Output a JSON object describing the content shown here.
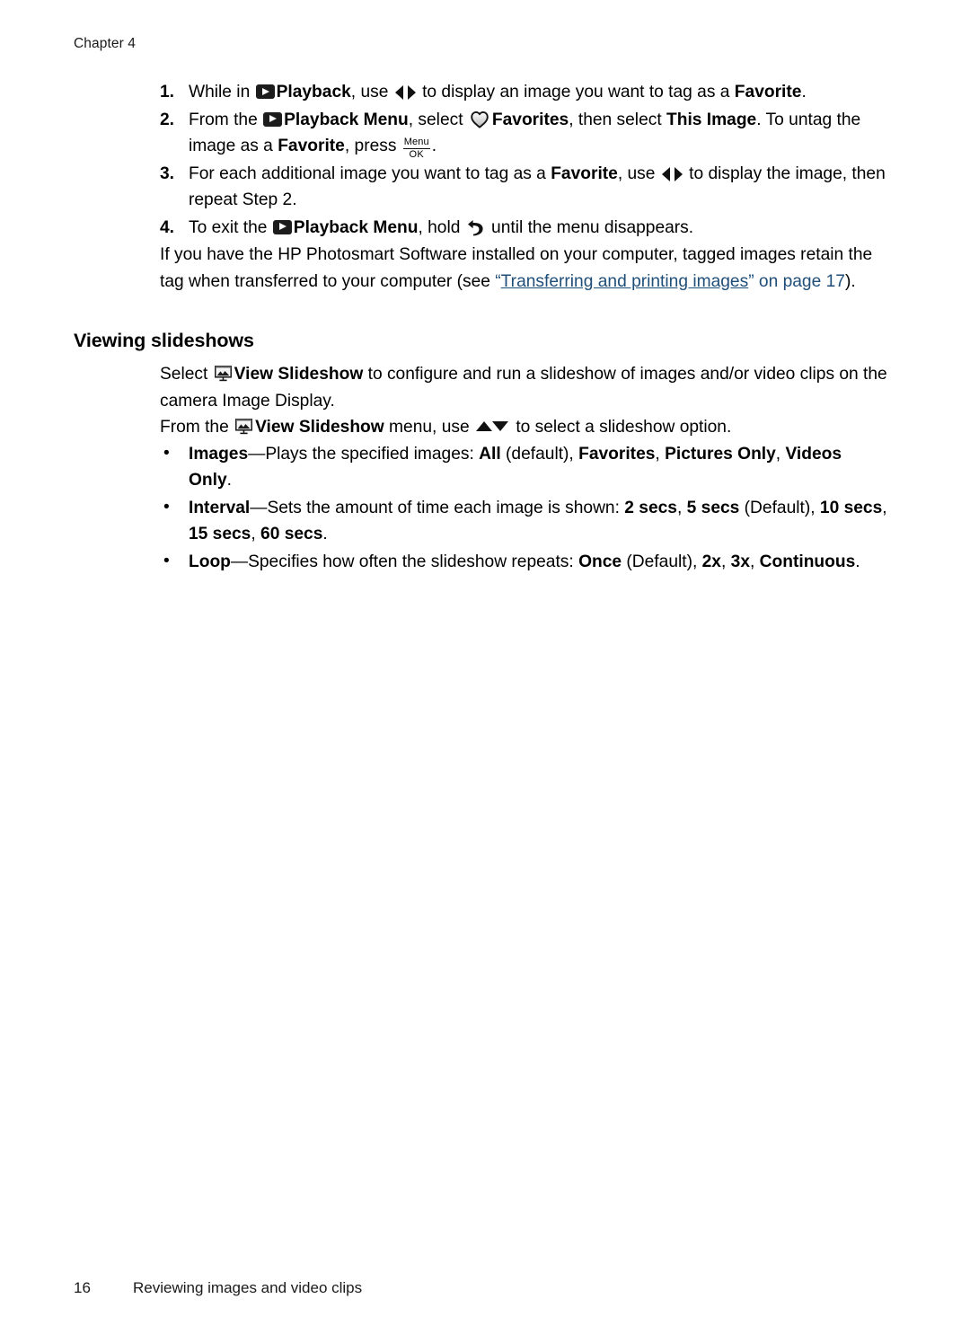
{
  "document": {
    "chapter_header": "Chapter 4",
    "page_number": "16",
    "footer_title": "Reviewing images and video clips",
    "link_color": "#1f4e79",
    "text_color": "#000000",
    "icon_color": "#1c1c1c"
  },
  "steps": [
    {
      "number": "1.",
      "segments": [
        {
          "type": "text",
          "value": "While in "
        },
        {
          "type": "icon",
          "name": "playback-icon"
        },
        {
          "type": "bold",
          "value": "Playback"
        },
        {
          "type": "text",
          "value": ", use "
        },
        {
          "type": "icon",
          "name": "left-right-arrows-icon"
        },
        {
          "type": "text",
          "value": " to display an image you want to tag as a "
        },
        {
          "type": "bold",
          "value": "Favorite"
        },
        {
          "type": "text",
          "value": "."
        }
      ],
      "plain": "While in Playback, use to display an image you want to tag as a Favorite."
    },
    {
      "number": "2.",
      "segments": [
        {
          "type": "text",
          "value": "From the "
        },
        {
          "type": "icon",
          "name": "playback-icon"
        },
        {
          "type": "bold",
          "value": "Playback Menu"
        },
        {
          "type": "text",
          "value": ", select "
        },
        {
          "type": "icon",
          "name": "heart-favorites-icon"
        },
        {
          "type": "bold",
          "value": "Favorites"
        },
        {
          "type": "text",
          "value": ", then select "
        },
        {
          "type": "bold",
          "value": "This Image"
        },
        {
          "type": "text",
          "value": ". To untag the image as a "
        },
        {
          "type": "bold",
          "value": "Favorite"
        },
        {
          "type": "text",
          "value": ", press "
        },
        {
          "type": "icon",
          "name": "menu-ok-button-icon",
          "top": "Menu",
          "bottom": "OK"
        },
        {
          "type": "text",
          "value": "."
        }
      ],
      "plain": "From the Playback Menu, select Favorites, then select This Image. To untag the image as a Favorite, press Menu/OK."
    },
    {
      "number": "3.",
      "segments": [
        {
          "type": "text",
          "value": "For each additional image you want to tag as a "
        },
        {
          "type": "bold",
          "value": "Favorite"
        },
        {
          "type": "text",
          "value": ", use "
        },
        {
          "type": "icon",
          "name": "left-right-arrows-icon"
        },
        {
          "type": "text",
          "value": " to display the image, then repeat Step 2."
        }
      ],
      "plain": "For each additional image you want to tag as a Favorite, use to display the image, then repeat Step 2."
    },
    {
      "number": "4.",
      "segments": [
        {
          "type": "text",
          "value": "To exit the "
        },
        {
          "type": "icon",
          "name": "playback-icon"
        },
        {
          "type": "bold",
          "value": "Playback Menu"
        },
        {
          "type": "text",
          "value": ", hold "
        },
        {
          "type": "icon",
          "name": "back-arrow-icon"
        },
        {
          "type": "text",
          "value": " until the menu disappears."
        }
      ],
      "plain": "To exit the Playback Menu, hold until the menu disappears."
    }
  ],
  "note_paragraph": {
    "lead": "If you have the HP Photosmart Software installed on your computer, tagged images retain the tag when transferred to your computer (see ",
    "open_quote": "“",
    "link_text": "Transferring and printing images",
    "close_quote": "”",
    "link_suffix": "on page 17",
    "tail": ")."
  },
  "section": {
    "heading": "Viewing slideshows",
    "paragraphs": [
      {
        "segments": [
          {
            "type": "text",
            "value": "Select "
          },
          {
            "type": "icon",
            "name": "slideshow-icon"
          },
          {
            "type": "bold",
            "value": "View Slideshow"
          },
          {
            "type": "text",
            "value": " to configure and run a slideshow of images and/or video clips on the camera Image Display."
          }
        ],
        "plain": "Select View Slideshow to configure and run a slideshow of images and/or video clips on the camera Image Display."
      },
      {
        "segments": [
          {
            "type": "text",
            "value": "From the "
          },
          {
            "type": "icon",
            "name": "slideshow-icon"
          },
          {
            "type": "bold",
            "value": "View Slideshow"
          },
          {
            "type": "text",
            "value": " menu, use "
          },
          {
            "type": "icon",
            "name": "up-down-arrows-icon"
          },
          {
            "type": "text",
            "value": " to select a slideshow option."
          }
        ],
        "plain": "From the View Slideshow menu, use to select a slideshow option."
      }
    ],
    "bullets": [
      {
        "bullet": "•",
        "term": "Images",
        "dash": "—",
        "description": "Plays the specified images: ",
        "options": [
          {
            "label": "All",
            "bold": true,
            "note": " (default), "
          },
          {
            "label": "Favorites",
            "bold": true,
            "note": ", "
          },
          {
            "label": "Pictures Only",
            "bold": true,
            "note": ", "
          },
          {
            "label": "Videos Only",
            "bold": true,
            "note": "."
          }
        ],
        "plain": "Images—Plays the specified images: All (default), Favorites, Pictures Only, Videos Only."
      },
      {
        "bullet": "•",
        "term": "Interval",
        "dash": "—",
        "description": "Sets the amount of time each image is shown: ",
        "options": [
          {
            "label": "2 secs",
            "bold": true,
            "note": ", "
          },
          {
            "label": "5 secs",
            "bold": true,
            "note": " (Default), "
          },
          {
            "label": "10 secs",
            "bold": true,
            "note": ", "
          },
          {
            "label": "15 secs",
            "bold": true,
            "note": ", "
          },
          {
            "label": "60 secs",
            "bold": true,
            "note": "."
          }
        ],
        "plain": "Interval—Sets the amount of time each image is shown: 2 secs, 5 secs (Default), 10 secs, 15 secs, 60 secs."
      },
      {
        "bullet": "•",
        "term": "Loop",
        "dash": "—",
        "description": "Specifies how often the slideshow repeats: ",
        "options": [
          {
            "label": "Once",
            "bold": true,
            "note": " (Default), "
          },
          {
            "label": "2x",
            "bold": true,
            "note": ", "
          },
          {
            "label": "3x",
            "bold": true,
            "note": ", "
          },
          {
            "label": "Continuous",
            "bold": true,
            "note": "."
          }
        ],
        "plain": "Loop—Specifies how often the slideshow repeats: Once (Default), 2x, 3x, Continuous."
      }
    ]
  }
}
